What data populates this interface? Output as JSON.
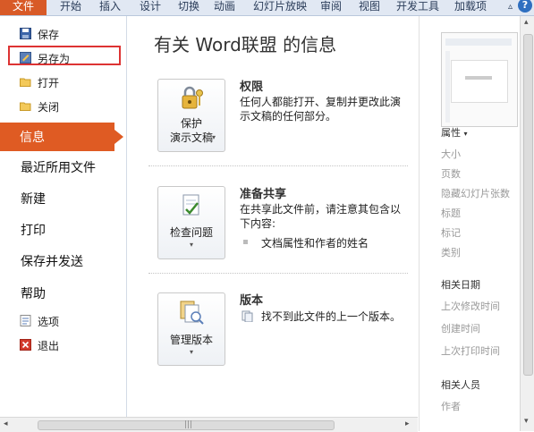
{
  "ribbon": {
    "file_tab": "文件",
    "tabs": [
      "开始",
      "插入",
      "设计",
      "切换",
      "动画",
      "幻灯片放映",
      "审阅",
      "视图",
      "开发工具",
      "加载项"
    ]
  },
  "sidebar": {
    "save": "保存",
    "save_as": "另存为",
    "open": "打开",
    "close": "关闭",
    "info": "信息",
    "recent": "最近所用文件",
    "new": "新建",
    "print": "打印",
    "save_send": "保存并发送",
    "help": "帮助",
    "options": "选项",
    "exit": "退出"
  },
  "main": {
    "title": "有关 Word联盟 的信息",
    "permissions": {
      "button_line1": "保护",
      "button_line2": "演示文稿",
      "heading": "权限",
      "desc": "任何人都能打开、复制并更改此演示文稿的任何部分。"
    },
    "prepare": {
      "button_label": "检查问题",
      "heading": "准备共享",
      "desc": "在共享此文件前，请注意其包含以下内容:",
      "bullet": "文档属性和作者的姓名"
    },
    "versions": {
      "button_label": "管理版本",
      "heading": "版本",
      "desc": "找不到此文件的上一个版本。"
    }
  },
  "right_panel": {
    "properties_header": "属性",
    "properties": [
      "大小",
      "页数",
      "隐藏幻灯片张数",
      "标题",
      "标记",
      "类别"
    ],
    "dates_header": "相关日期",
    "dates": [
      "上次修改时间",
      "创建时间",
      "上次打印时间"
    ],
    "people_header": "相关人员",
    "people": [
      "作者"
    ]
  },
  "colors": {
    "accent": "#df5b23",
    "highlight_border": "#dd3333"
  }
}
